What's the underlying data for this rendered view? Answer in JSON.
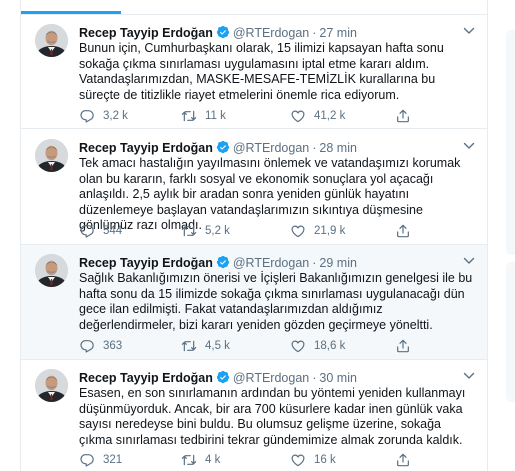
{
  "author": {
    "name": "Recep Tayyip Erdoğan",
    "handle": "@RTErdogan"
  },
  "accent_color": "#1da1f2",
  "tweets": [
    {
      "time": "27 min",
      "text": "Bunun için, Cumhurbaşkanı olarak, 15 ilimizi kapsayan hafta sonu sokağa çıkma sınırlaması uygulamasını iptal etme kararı aldım. Vatandaşlarımızdan, MASKE-MESAFE-TEMİZLİK kurallarına bu süreçte de titizlikle riayet etmelerini önemle rica ediyorum.",
      "replies": "3,2 k",
      "retweets": "11 k",
      "likes": "41,2 k"
    },
    {
      "time": "28 min",
      "text": "Tek amacı hastalığın yayılmasını önlemek ve vatandaşımızı korumak olan bu kararın, farklı sosyal ve ekonomik sonuçlara yol açacağı anlaşıldı. 2,5 aylık bir aradan sonra yeniden günlük hayatını düzenlemeye başlayan vatandaşlarımızın sıkıntıya düşmesine gönlümüz razı olmadı.",
      "replies": "544",
      "retweets": "5,2 k",
      "likes": "21,9 k"
    },
    {
      "time": "29 min",
      "text": "Sağlık Bakanlığımızın önerisi ve İçişleri Bakanlığımızın genelgesi ile bu hafta sonu da 15 ilimizde sokağa çıkma sınırlaması uygulanacağı dün gece ilan edilmişti. Fakat vatandaşlarımızdan aldığımız değerlendirmeler, bizi kararı yeniden gözden geçirmeye yöneltti.",
      "replies": "363",
      "retweets": "4,5 k",
      "likes": "18,6 k"
    },
    {
      "time": "30 min",
      "text": "Esasen, en son sınırlamanın ardından bu yöntemi yeniden kullanmayı düşünmüyorduk. Ancak, bir ara 700 küsurlere kadar inen günlük vaka sayısı neredeyse bini buldu. Bu olumsuz gelişme üzerine, sokağa çıkma sınırlaması tedbirini tekrar gündemimize almak zorunda kaldık.",
      "replies": "321",
      "retweets": "4 k",
      "likes": "16 k"
    }
  ]
}
